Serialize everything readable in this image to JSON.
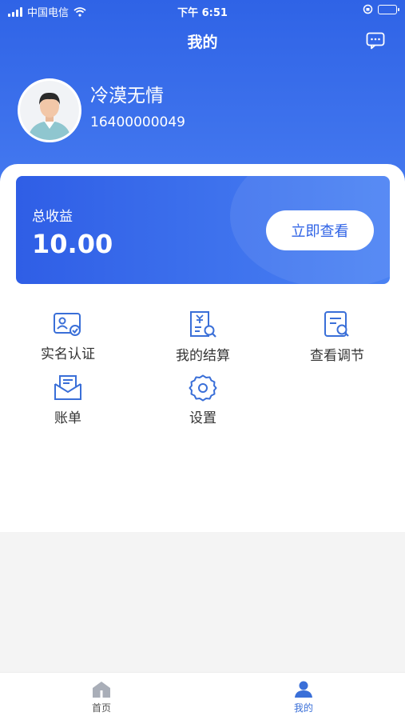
{
  "status_bar": {
    "carrier": "中国电信",
    "time": "下午 6:51"
  },
  "header": {
    "title": "我的",
    "message_icon": "chat-bubble-icon"
  },
  "profile": {
    "name": "冷漠无情",
    "phone": "16400000049",
    "avatar_icon": "user-avatar-icon"
  },
  "earnings": {
    "label": "总收益",
    "value": "10.00",
    "button_label": "立即查看"
  },
  "menu": [
    {
      "label": "实名认证",
      "icon": "id-card-check-icon"
    },
    {
      "label": "我的结算",
      "icon": "settlement-document-icon"
    },
    {
      "label": "查看调节",
      "icon": "document-search-icon"
    },
    {
      "label": "账单",
      "icon": "bill-envelope-icon"
    },
    {
      "label": "设置",
      "icon": "settings-gear-icon"
    }
  ],
  "tabbar": {
    "items": [
      {
        "label": "首页",
        "icon": "home-icon",
        "active": false
      },
      {
        "label": "我的",
        "icon": "user-profile-icon",
        "active": true
      }
    ]
  },
  "colors": {
    "accent": "#2f63e6",
    "icon": "#3a6fd8",
    "tab_inactive": "#888888"
  }
}
